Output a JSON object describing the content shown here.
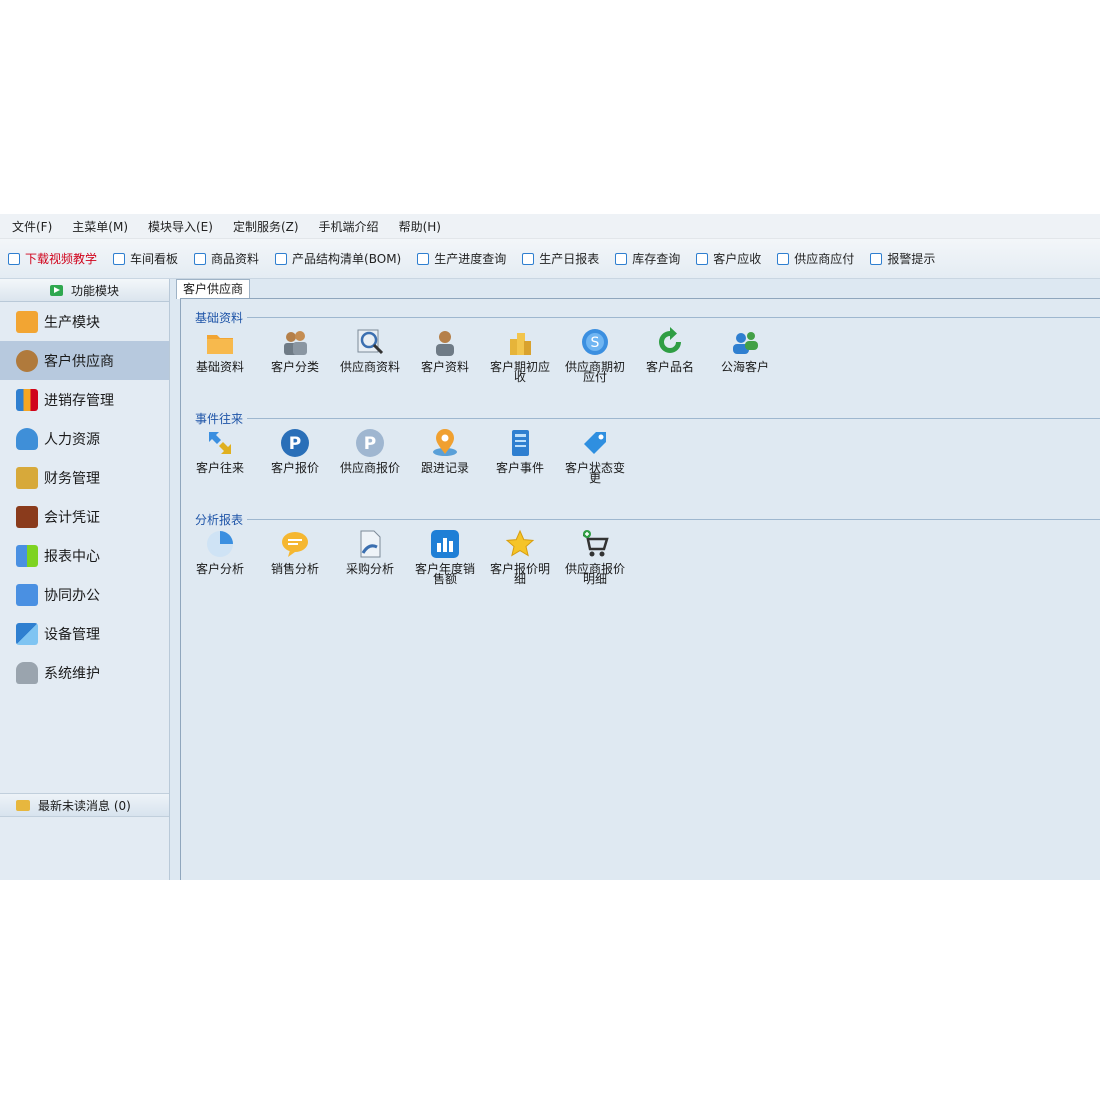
{
  "menu": [
    "文件(F)",
    "主菜单(M)",
    "模块导入(E)",
    "定制服务(Z)",
    "手机端介绍",
    "帮助(H)"
  ],
  "toolbar": [
    "下载视频教学",
    "车间看板",
    "商品资料",
    "产品结构清单(BOM)",
    "生产进度查询",
    "生产日报表",
    "库存查询",
    "客户应收",
    "供应商应付",
    "报警提示"
  ],
  "sidebar": {
    "header": "功能模块",
    "items": [
      "生产模块",
      "客户供应商",
      "进销存管理",
      "人力资源",
      "财务管理",
      "会计凭证",
      "报表中心",
      "协同办公",
      "设备管理",
      "系统维护"
    ],
    "active_index": 1,
    "footer": "最新未读消息 (0)"
  },
  "tab": "客户供应商",
  "sections": [
    {
      "title": "基础资料",
      "items": [
        "基础资料",
        "客户分类",
        "供应商资料",
        "客户资料",
        "客户期初应收",
        "供应商期初应付",
        "客户品名",
        "公海客户"
      ]
    },
    {
      "title": "事件往来",
      "items": [
        "客户往来",
        "客户报价",
        "供应商报价",
        "跟进记录",
        "客户事件",
        "客户状态变更"
      ]
    },
    {
      "title": "分析报表",
      "items": [
        "客户分析",
        "销售分析",
        "采购分析",
        "客户年度销售额",
        "客户报价明细",
        "供应商报价明细"
      ]
    }
  ],
  "colors": {
    "accent": "#2f7fd0",
    "warning_text": "#d0021b",
    "sidebar_active": "#b7c9de",
    "section_title": "#1f55a8"
  }
}
